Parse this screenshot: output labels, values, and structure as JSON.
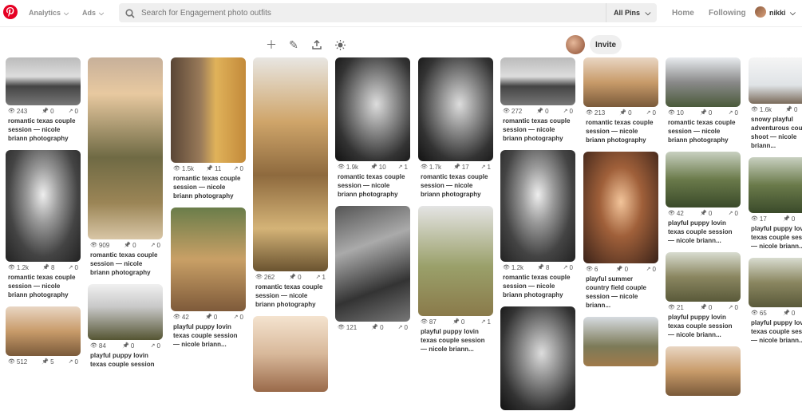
{
  "app": {
    "logo": "pinterest-logo",
    "brand_color": "#e60023"
  },
  "nav": {
    "analytics_label": "Analytics",
    "ads_label": "Ads",
    "search_placeholder": "Search for Engagement photo outfits",
    "search_scope": "All Pins",
    "home_label": "Home",
    "following_label": "Following",
    "user_name": "nikki"
  },
  "board_tools": {
    "invite_label": "Invite"
  },
  "columns": [
    [
      {
        "saves": "243",
        "repins": "0",
        "shares": "0",
        "title": "romantic texas couple session — nicole briann photography",
        "img": "bw-sm"
      },
      {
        "saves": "1.2k",
        "repins": "8",
        "shares": "0",
        "title": "romantic texas couple session — nicole briann photography",
        "img": "bw-lg"
      },
      {
        "saves": "512",
        "repins": "5",
        "shares": "0",
        "title": "",
        "img": "warm-sm"
      }
    ],
    [
      {
        "saves": "909",
        "repins": "0",
        "shares": "0",
        "title": "romantic texas couple session — nicole briann photography",
        "img": "field-tall"
      },
      {
        "saves": "84",
        "repins": "0",
        "shares": "0",
        "title": "playful puppy lovin texas couple session",
        "img": "cool-sm"
      }
    ],
    [
      {
        "saves": "1.5k",
        "repins": "11",
        "shares": "0",
        "title": "romantic texas couple session — nicole briann photography",
        "img": "barn-md"
      },
      {
        "saves": "42",
        "repins": "0",
        "shares": "0",
        "title": "playful puppy lovin texas couple session — nicole briann...",
        "img": "dog-md"
      }
    ],
    [
      {
        "saves": "262",
        "repins": "0",
        "shares": "1",
        "title": "romantic texas couple session — nicole briann photography",
        "img": "giraffe-tall"
      },
      {
        "saves": "",
        "repins": "",
        "shares": "",
        "title": "",
        "img": "beach-md"
      }
    ],
    [
      {
        "saves": "1.9k",
        "repins": "10",
        "shares": "1",
        "title": "romantic texas couple session — nicole briann photography",
        "img": "bw-md"
      },
      {
        "saves": "121",
        "repins": "0",
        "shares": "0",
        "title": "",
        "img": "bw-tall"
      }
    ],
    [
      {
        "saves": "1.7k",
        "repins": "17",
        "shares": "1",
        "title": "romantic texas couple session — nicole briann photography",
        "img": "bw-md"
      },
      {
        "saves": "87",
        "repins": "0",
        "shares": "1",
        "title": "playful puppy lovin texas couple session — nicole briann...",
        "img": "tree-md"
      }
    ],
    [
      {
        "saves": "272",
        "repins": "0",
        "shares": "0",
        "title": "romantic texas couple session — nicole briann photography",
        "img": "bw-sm"
      },
      {
        "saves": "1.2k",
        "repins": "8",
        "shares": "0",
        "title": "romantic texas couple session — nicole briann photography",
        "img": "bw-lg"
      },
      {
        "saves": "",
        "repins": "",
        "shares": "",
        "title": "",
        "img": "bw-md"
      }
    ],
    [
      {
        "saves": "213",
        "repins": "0",
        "shares": "0",
        "title": "romantic texas couple session — nicole briann photography",
        "img": "warm-sm"
      },
      {
        "saves": "6",
        "repins": "0",
        "shares": "0",
        "title": "playful summer country field couple session — nicole briann...",
        "img": "kiss-lg"
      },
      {
        "saves": "",
        "repins": "",
        "shares": "",
        "title": "",
        "img": "dog-sm"
      }
    ],
    [
      {
        "saves": "10",
        "repins": "0",
        "shares": "0",
        "title": "romantic texas couple session — nicole briann photography",
        "img": "group-sm"
      },
      {
        "saves": "42",
        "repins": "0",
        "shares": "0",
        "title": "playful puppy lovin texas couple session — nicole briann...",
        "img": "green-md"
      },
      {
        "saves": "21",
        "repins": "0",
        "shares": "0",
        "title": "playful puppy lovin texas couple session — nicole briann...",
        "img": "green-sm"
      },
      {
        "saves": "",
        "repins": "",
        "shares": "",
        "title": "",
        "img": "warm-sm"
      }
    ],
    [
      {
        "saves": "1.6k",
        "repins": "0",
        "shares": "0",
        "title": "snowy playful adventurous couple shoot — nicole briann...",
        "img": "snow-sm"
      },
      {
        "saves": "17",
        "repins": "0",
        "shares": "0",
        "title": "playful puppy lovin texas couple session — nicole briann...",
        "img": "green-md"
      },
      {
        "saves": "65",
        "repins": "0",
        "shares": "0",
        "title": "playful puppy lovin texas couple session — nicole briann...",
        "img": "green-sm"
      }
    ]
  ]
}
